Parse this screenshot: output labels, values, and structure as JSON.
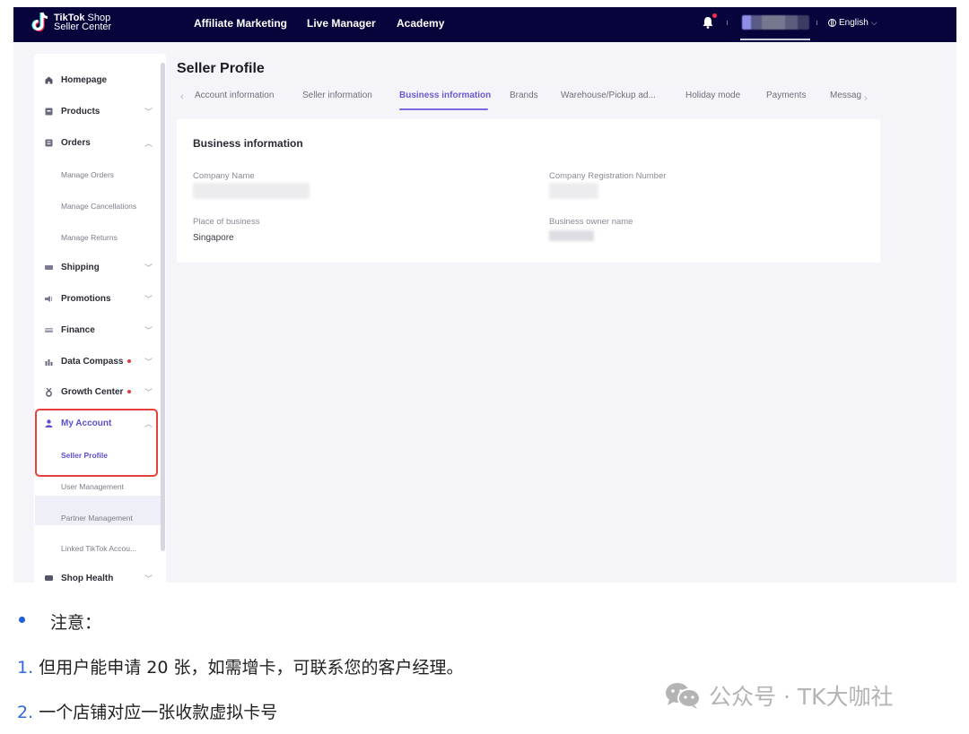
{
  "app": {
    "brand_line1_bold": "TikTok",
    "brand_line1_light": " Shop",
    "brand_line2": "Seller Center"
  },
  "topnav": {
    "links": [
      "Affiliate Marketing",
      "Live Manager",
      "Academy"
    ],
    "notification_badge": true,
    "account_name": "[blurred]",
    "language": "English"
  },
  "sidebar": {
    "items": [
      {
        "label": "Homepage",
        "icon": "home-icon",
        "expandable": false
      },
      {
        "label": "Products",
        "icon": "products-icon",
        "expandable": true,
        "expanded": false
      },
      {
        "label": "Orders",
        "icon": "orders-icon",
        "expandable": true,
        "expanded": true,
        "children": [
          "Manage Orders",
          "Manage Cancellations",
          "Manage Returns"
        ]
      },
      {
        "label": "Shipping",
        "icon": "truck-icon",
        "expandable": true,
        "expanded": false
      },
      {
        "label": "Promotions",
        "icon": "megaphone-icon",
        "expandable": true,
        "expanded": false
      },
      {
        "label": "Finance",
        "icon": "card-icon",
        "expandable": true,
        "expanded": false
      },
      {
        "label": "Data Compass",
        "icon": "bar-chart-icon",
        "expandable": true,
        "expanded": false,
        "badge_dot": true
      },
      {
        "label": "Growth Center",
        "icon": "medal-icon",
        "expandable": true,
        "expanded": false,
        "badge_dot": true
      },
      {
        "label": "My Account",
        "icon": "user-icon",
        "expandable": true,
        "expanded": true,
        "active": true,
        "children": [
          "Seller Profile",
          "User Management",
          "Partner Management",
          "Linked TikTok Accou..."
        ]
      },
      {
        "label": "Shop Health",
        "icon": "health-icon",
        "expandable": true,
        "expanded": false
      }
    ],
    "active_child": "Seller Profile"
  },
  "main": {
    "title": "Seller Profile",
    "tabs": [
      {
        "label": "Account information",
        "active": false
      },
      {
        "label": "Seller information",
        "active": false
      },
      {
        "label": "Business information",
        "active": true
      },
      {
        "label": "Brands",
        "active": false
      },
      {
        "label": "Warehouse/Pickup ad...",
        "active": false
      },
      {
        "label": "Holiday mode",
        "active": false
      },
      {
        "label": "Payments",
        "active": false
      },
      {
        "label": "Messag",
        "active": false
      }
    ],
    "card": {
      "title": "Business information",
      "fields": [
        {
          "label": "Company Name",
          "value": "[blurred]"
        },
        {
          "label": "Company Registration Number",
          "value": "[blurred]"
        },
        {
          "label": "Place of business",
          "value": "Singapore"
        },
        {
          "label": "Business owner name",
          "value": "[blurred]"
        }
      ]
    }
  },
  "article": {
    "note_heading": "注意：",
    "items": [
      {
        "num": "1.",
        "text": "但用户能申请 20 张，如需增卡，可联系您的客户经理。"
      },
      {
        "num": "2.",
        "text": "一个店铺对应一张收款虚拟卡号"
      }
    ],
    "watermark": "公众号 · TK大咖社"
  },
  "colors": {
    "topbar_bg": "#06043b",
    "accent": "#6a5ad6",
    "highlight_box": "#e8403d",
    "list_number": "#2f6ad6",
    "badge_dot": "#e4393c"
  }
}
